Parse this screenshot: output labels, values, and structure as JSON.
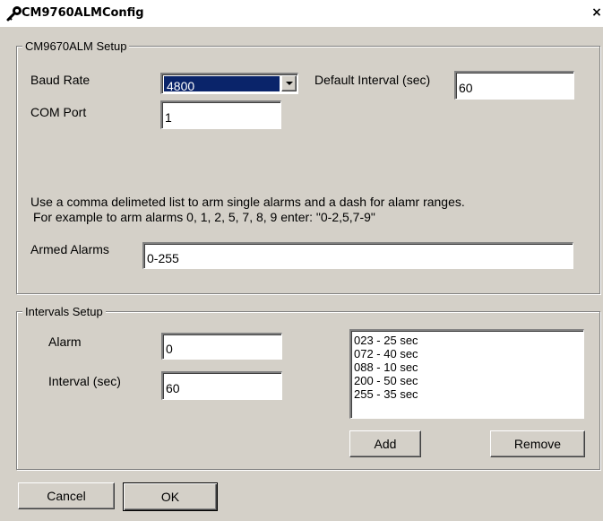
{
  "window": {
    "title": "CM9760ALMConfig",
    "close_glyph": "×",
    "icon": "wrench-key-icon"
  },
  "setup": {
    "legend": "CM9670ALM Setup",
    "baud_rate_label": "Baud Rate",
    "baud_rate_value": "4800",
    "default_interval_label": "Default Interval (sec)",
    "default_interval_value": "60",
    "com_port_label": "COM Port",
    "com_port_value": "1",
    "help_line1": "Use a comma delimeted list to arm single alarms and a dash for alamr ranges.",
    "help_line2": "For example to arm alarms 0, 1, 2, 5, 7, 8, 9  enter: \"0-2,5,7-9\"",
    "armed_alarms_label": "Armed Alarms",
    "armed_alarms_value": "0-255"
  },
  "intervals": {
    "legend": "Intervals Setup",
    "alarm_label": "Alarm",
    "alarm_value": "0",
    "interval_label": "Interval (sec)",
    "interval_value": "60",
    "list_items": [
      "023 - 25 sec",
      "072 - 40 sec",
      "088 - 10 sec",
      "200 - 50 sec",
      "255 - 35 sec"
    ],
    "add_label": "Add",
    "remove_label": "Remove"
  },
  "footer": {
    "cancel_label": "Cancel",
    "ok_label": "OK"
  },
  "colors": {
    "dialog_bg": "#d4d0c8",
    "selection": "#0a246a"
  }
}
